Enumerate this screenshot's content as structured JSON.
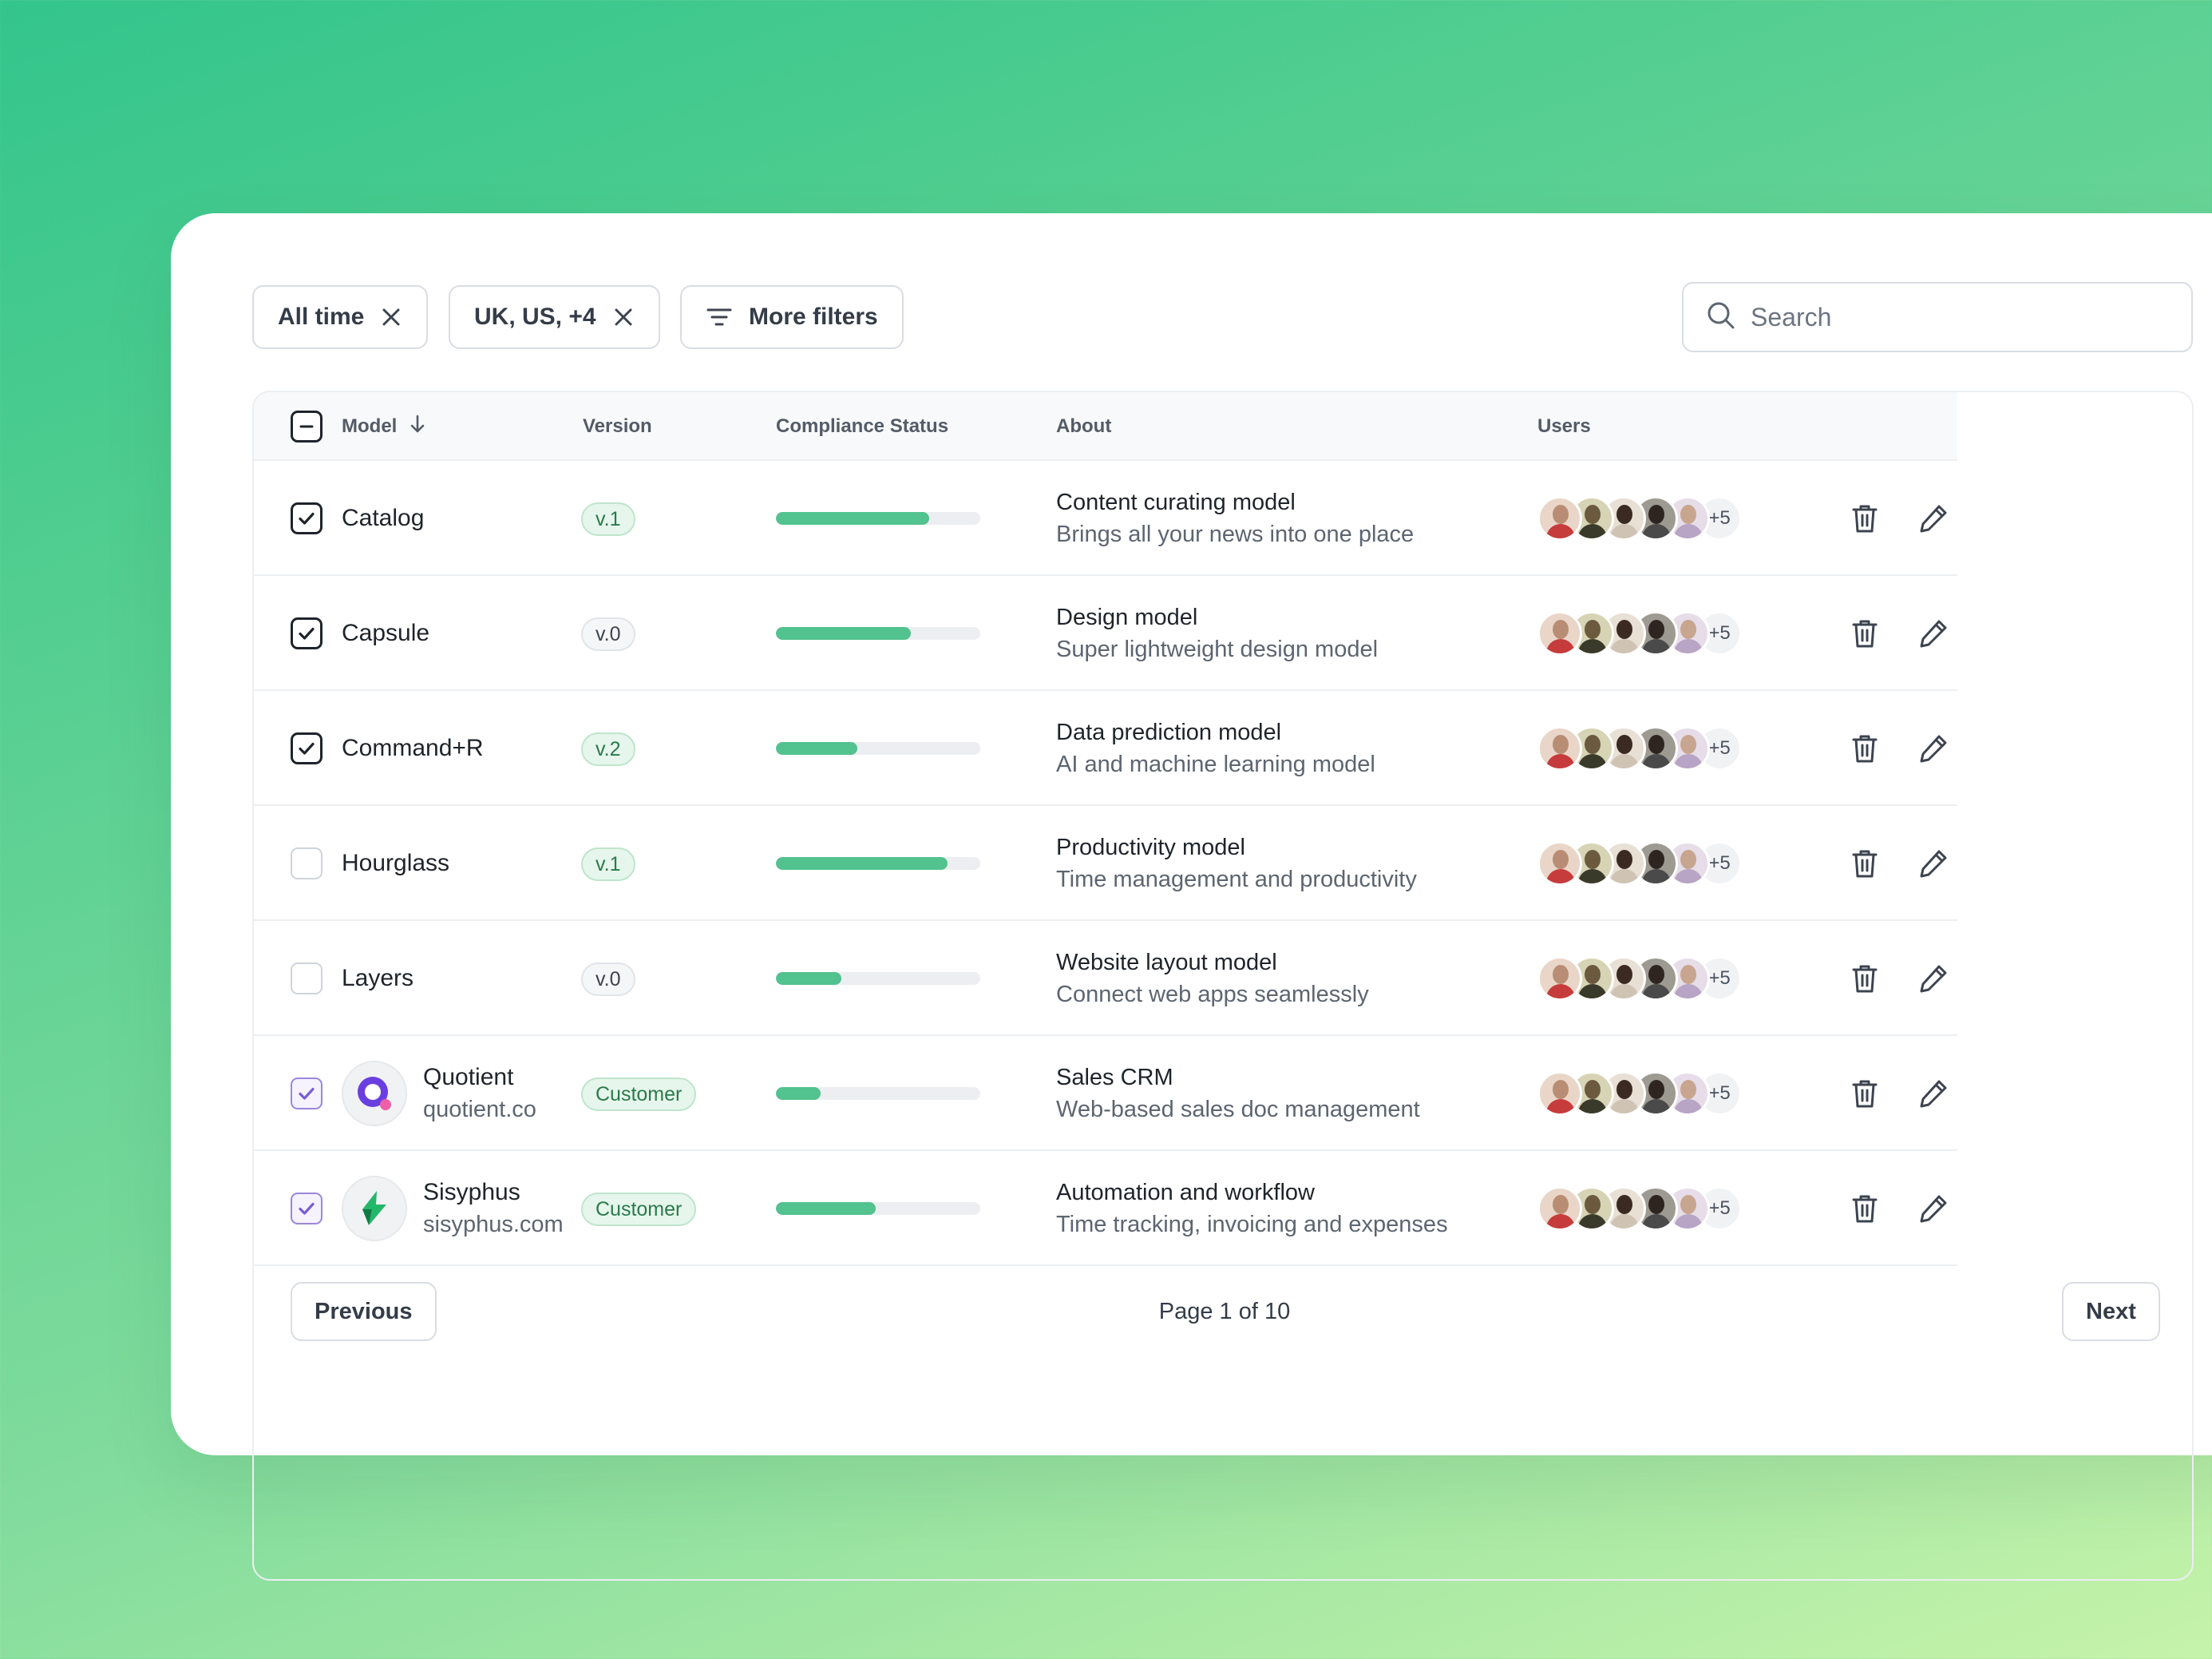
{
  "filters": {
    "chips": [
      {
        "label": "All time"
      },
      {
        "label": "UK, US, +4"
      }
    ],
    "more_filters_label": "More filters",
    "search_placeholder": "Search"
  },
  "table": {
    "columns": {
      "model": "Model",
      "version": "Version",
      "compliance": "Compliance Status",
      "about": "About",
      "users": "Users"
    },
    "rows": [
      {
        "name": "Catalog",
        "checked": true,
        "version": "v.1",
        "badge_style": "green",
        "compliance": 0.75,
        "about_title": "Content curating model",
        "about_sub": "Brings all your news into one place",
        "users_more": "+5"
      },
      {
        "name": "Capsule",
        "checked": true,
        "version": "v.0",
        "badge_style": "gray",
        "compliance": 0.66,
        "about_title": "Design model",
        "about_sub": "Super lightweight design model",
        "users_more": "+5"
      },
      {
        "name": "Command+R",
        "checked": true,
        "version": "v.2",
        "badge_style": "green",
        "compliance": 0.4,
        "about_title": "Data prediction model",
        "about_sub": "AI and machine learning model",
        "users_more": "+5"
      },
      {
        "name": "Hourglass",
        "checked": false,
        "version": "v.1",
        "badge_style": "green",
        "compliance": 0.84,
        "about_title": "Productivity model",
        "about_sub": "Time management and productivity",
        "users_more": "+5"
      },
      {
        "name": "Layers",
        "checked": false,
        "version": "v.0",
        "badge_style": "gray",
        "compliance": 0.32,
        "about_title": "Website layout model",
        "about_sub": "Connect web apps seamlessly",
        "users_more": "+5"
      },
      {
        "name": "Quotient",
        "domain": "quotient.co",
        "checked": true,
        "version": "Customer",
        "badge_style": "green",
        "compliance": 0.22,
        "about_title": "Sales CRM",
        "about_sub": "Web-based sales doc management",
        "users_more": "+5"
      },
      {
        "name": "Sisyphus",
        "domain": "sisyphus.com",
        "checked": true,
        "version": "Customer",
        "badge_style": "green",
        "compliance": 0.49,
        "about_title": "Automation and workflow",
        "about_sub": "Time tracking, invoicing and expenses",
        "users_more": "+5"
      }
    ]
  },
  "pagination": {
    "previous_label": "Previous",
    "page_label": "Page 1 of 10",
    "next_label": "Next"
  },
  "colors": {
    "accent_green": "#52c28e",
    "check_purple": "#7a5cd6",
    "quotient_purple": "#6a3fe0",
    "sisyphus_green": "#22b86a"
  }
}
